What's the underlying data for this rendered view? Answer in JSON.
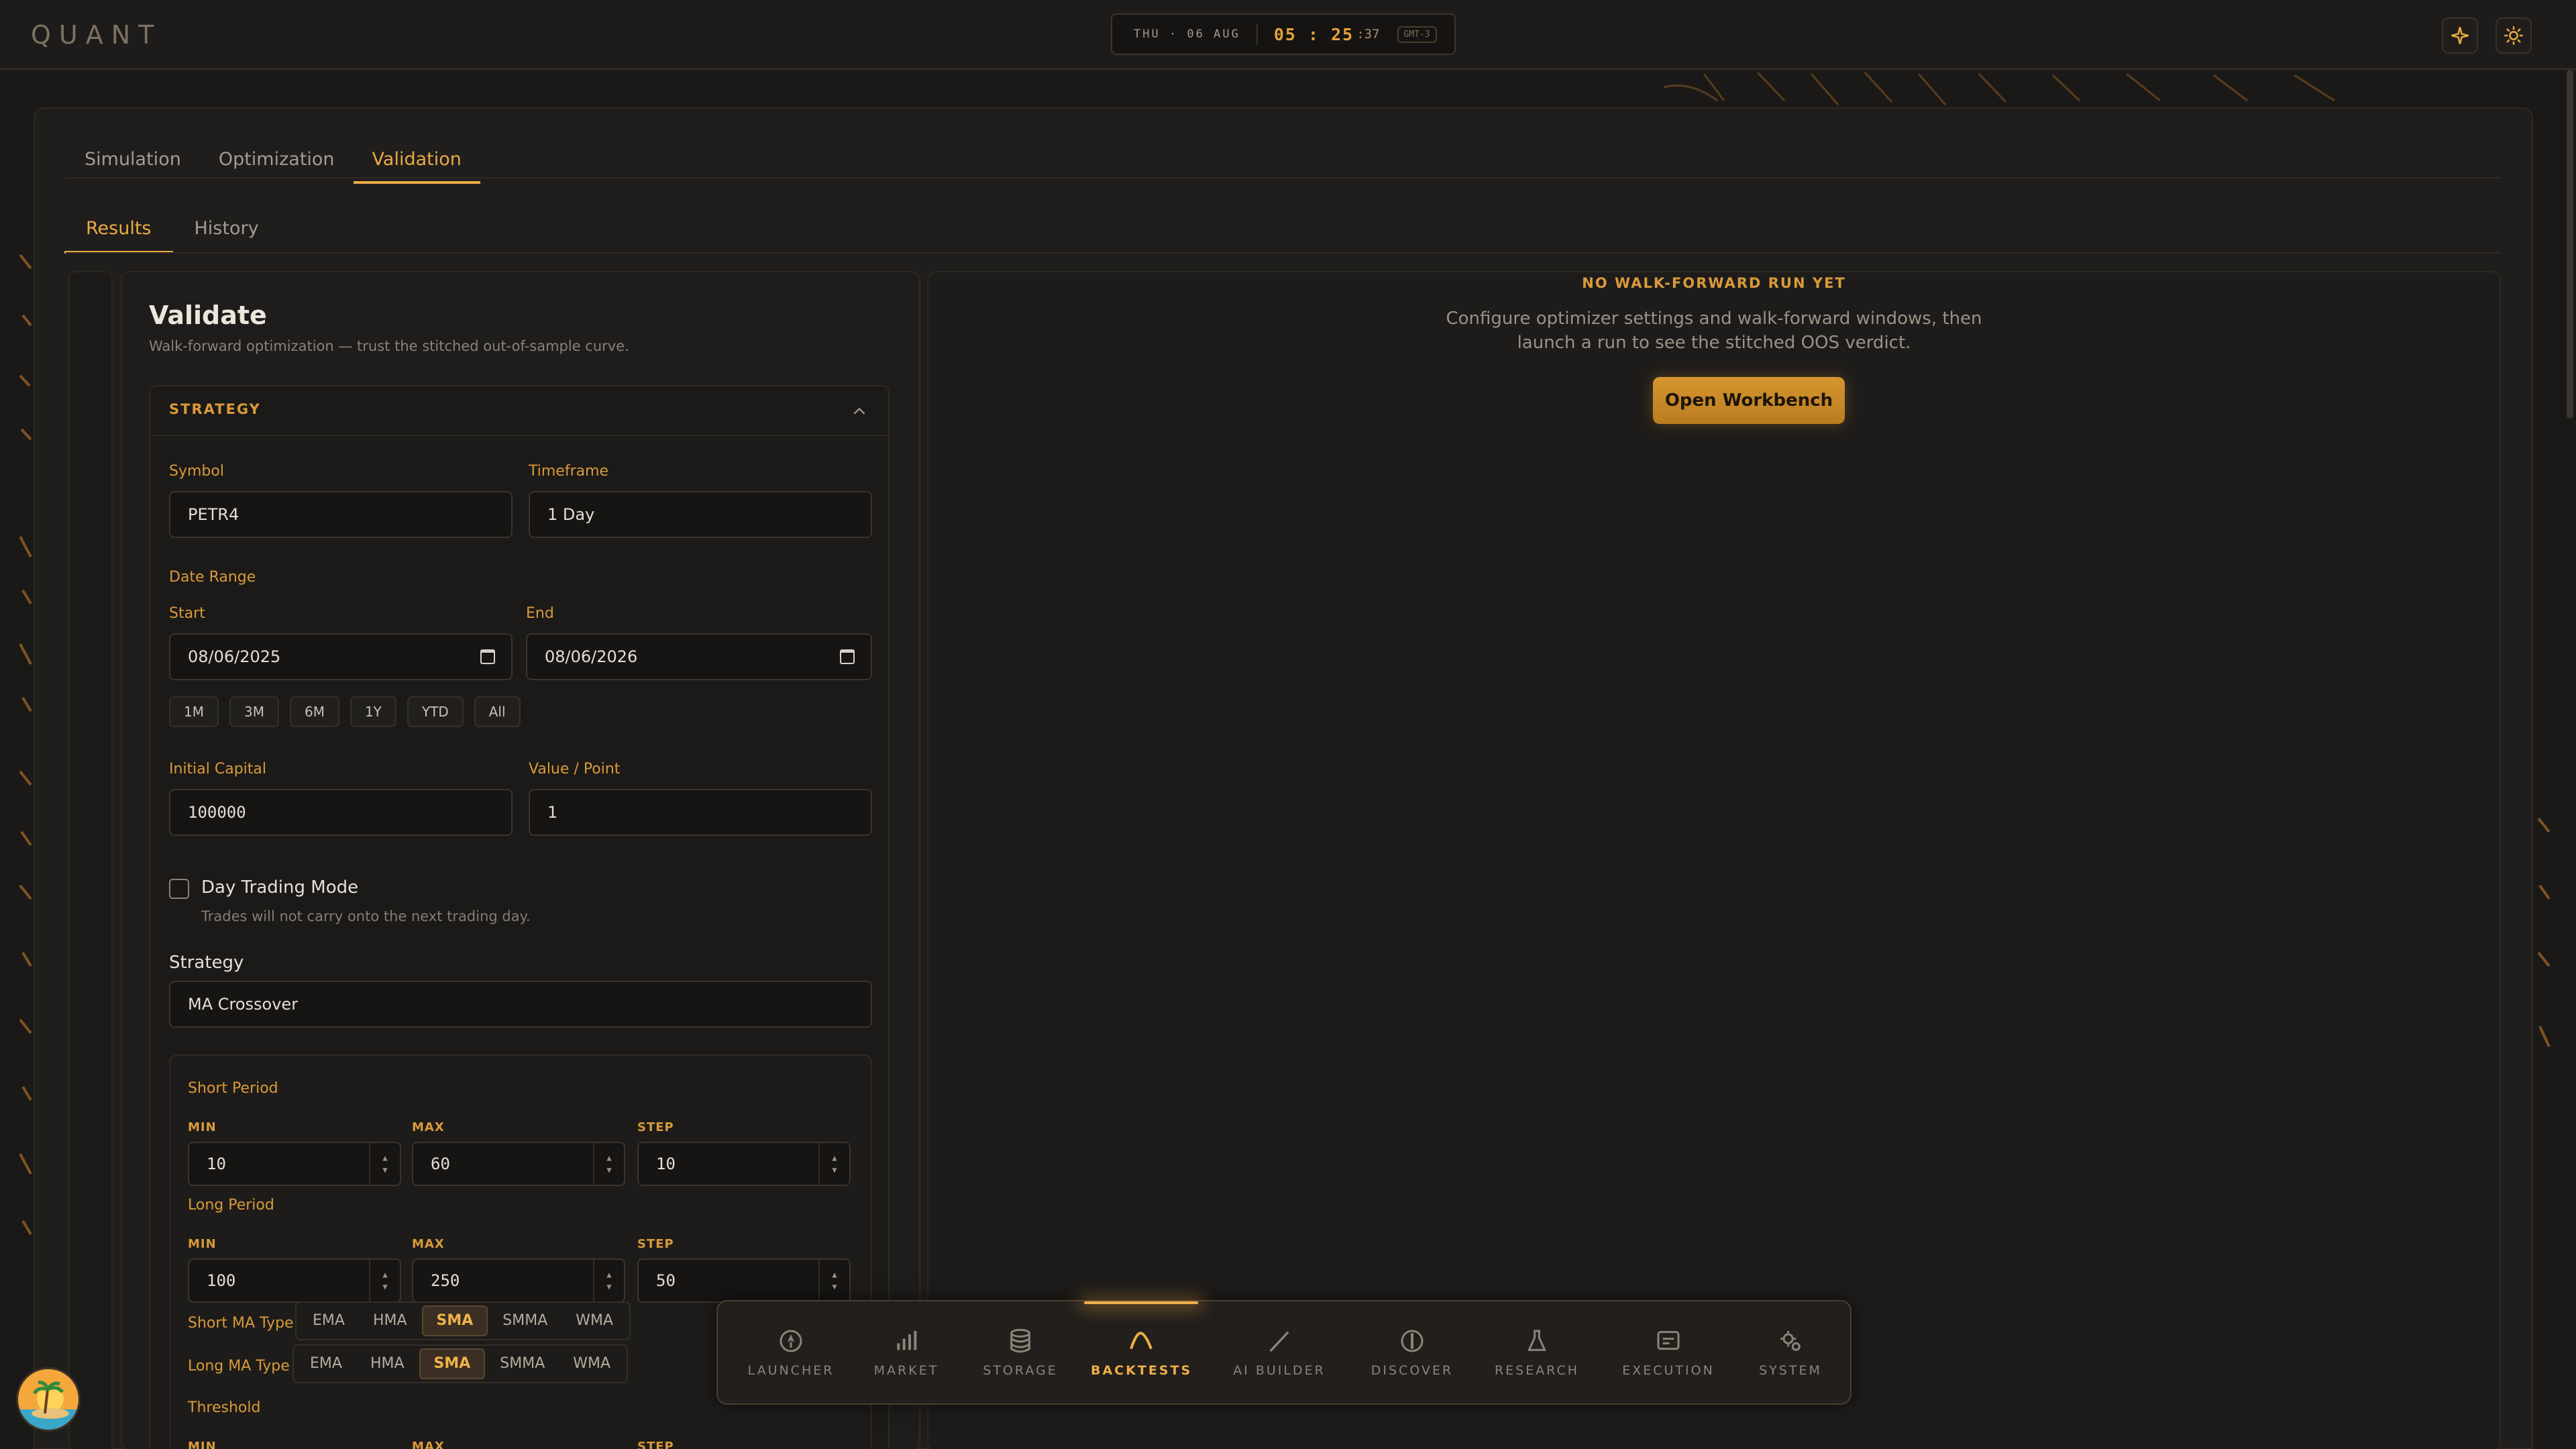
{
  "app": {
    "logo": "QUANT"
  },
  "clock": {
    "day": "THU · 06 AUG",
    "time": "05 : 25",
    "seconds": ":37",
    "tz": "GMT-3"
  },
  "top_icons": [
    "sparkle-icon",
    "sun-icon"
  ],
  "tabs": {
    "primary": [
      "Simulation",
      "Optimization",
      "Validation"
    ],
    "primary_active": "Validation",
    "secondary": [
      "Results",
      "History"
    ],
    "secondary_active": "Results"
  },
  "validate": {
    "title": "Validate",
    "subtitle": "Walk-forward optimization — trust the stitched out-of-sample curve.",
    "section": "STRATEGY",
    "symbol_label": "Symbol",
    "symbol_value": "PETR4",
    "timeframe_label": "Timeframe",
    "timeframe_value": "1 Day",
    "date_range_label": "Date Range",
    "start_label": "Start",
    "start_value": "08/06/2025",
    "end_label": "End",
    "end_value": "08/06/2026",
    "presets": [
      "1M",
      "3M",
      "6M",
      "1Y",
      "YTD",
      "All"
    ],
    "capital_label": "Initial Capital",
    "capital_value": "100000",
    "value_point_label": "Value / Point",
    "value_point_value": "1",
    "day_trading_label": "Day Trading Mode",
    "day_trading_hint": "Trades will not carry onto the next trading day.",
    "day_trading_checked": false,
    "strategy_label": "Strategy",
    "strategy_value": "MA Crossover",
    "short_period": {
      "label": "Short Period",
      "min_label": "MIN",
      "max_label": "MAX",
      "step_label": "STEP",
      "min": "10",
      "max": "60",
      "step": "10"
    },
    "long_period": {
      "label": "Long Period",
      "min_label": "MIN",
      "max_label": "MAX",
      "step_label": "STEP",
      "min": "100",
      "max": "250",
      "step": "50"
    },
    "short_ma_type": {
      "label": "Short MA Type",
      "options": [
        "EMA",
        "HMA",
        "SMA",
        "SMMA",
        "WMA"
      ],
      "selected": "SMA"
    },
    "long_ma_type": {
      "label": "Long MA Type",
      "options": [
        "EMA",
        "HMA",
        "SMA",
        "SMMA",
        "WMA"
      ],
      "selected": "SMA"
    },
    "threshold": {
      "label": "Threshold",
      "min_label": "MIN",
      "max_label": "MAX",
      "step_label": "STEP"
    }
  },
  "empty_state": {
    "title": "NO WALK-FORWARD RUN YET",
    "line1": "Configure optimizer settings and walk-forward windows, then",
    "line2": "launch a run to see the stitched OOS verdict.",
    "button": "Open Workbench"
  },
  "dock": {
    "items": [
      {
        "label": "LAUNCHER",
        "icon": "rocket-icon"
      },
      {
        "label": "MARKET",
        "icon": "bar-chart-icon"
      },
      {
        "label": "STORAGE",
        "icon": "database-icon"
      },
      {
        "label": "BACKTESTS",
        "icon": "curve-icon"
      },
      {
        "label": "AI BUILDER",
        "icon": "wand-icon"
      },
      {
        "label": "DISCOVER",
        "icon": "compass-icon"
      },
      {
        "label": "RESEARCH",
        "icon": "flask-icon"
      },
      {
        "label": "EXECUTION",
        "icon": "terminal-icon"
      },
      {
        "label": "SYSTEM",
        "icon": "gears-icon"
      }
    ],
    "active": "BACKTESTS"
  },
  "colors": {
    "accent": "#e9aa45",
    "background": "#1b1917",
    "panel": "#1f1d1b",
    "button": "#c98a2a"
  }
}
